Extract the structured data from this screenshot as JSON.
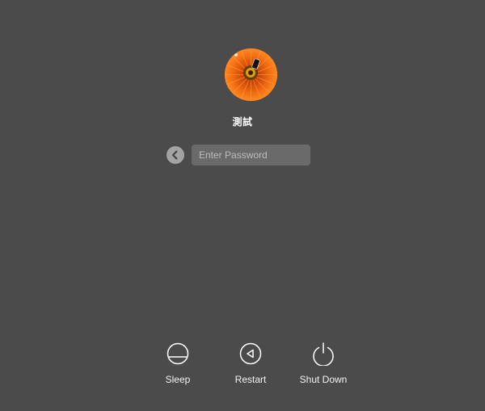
{
  "login": {
    "username": "測試",
    "password_placeholder": "Enter Password",
    "avatar_icon": "orange-gerbera-flower-avatar",
    "back_icon": "chevron-left-icon"
  },
  "actions": [
    {
      "label": "Sleep",
      "icon": "sleep-icon"
    },
    {
      "label": "Restart",
      "icon": "restart-icon"
    },
    {
      "label": "Shut Down",
      "icon": "power-icon"
    }
  ],
  "colors": {
    "background": "#4b4b4b",
    "field": "#6a6a6a",
    "back_button": "#a3a3a3",
    "text": "#ffffff"
  }
}
